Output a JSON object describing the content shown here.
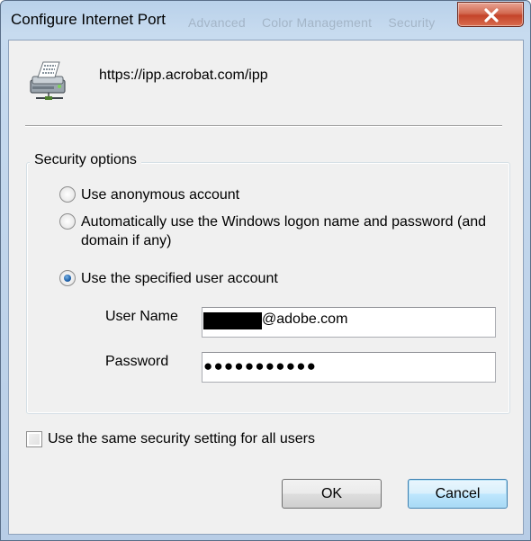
{
  "window": {
    "title": "Configure Internet Port",
    "background_tabs": [
      "Advanced",
      "Color Management",
      "Security"
    ]
  },
  "header": {
    "url": "https://ipp.acrobat.com/ipp"
  },
  "security_options": {
    "legend": "Security options",
    "radio_anonymous": "Use anonymous account",
    "radio_windows_logon_line1": "Automatically use the Windows logon name and password (and",
    "radio_windows_logon_line2": "domain if any)",
    "radio_specified": "Use the specified user account",
    "selected": "specified",
    "user_name_label": "User Name",
    "user_name_value_suffix": "@adobe.com",
    "password_label": "Password",
    "password_value": "●●●●●●●●●●●"
  },
  "same_setting_checkbox": {
    "label": "Use the same security setting for all users",
    "checked": false
  },
  "buttons": {
    "ok": "OK",
    "cancel": "Cancel"
  },
  "icons": [
    "printer-network-icon",
    "close-icon"
  ],
  "colors": {
    "accent": "#3c7fb1",
    "close_button": "#c4442a",
    "dialog_background": "#f0f0f0"
  }
}
